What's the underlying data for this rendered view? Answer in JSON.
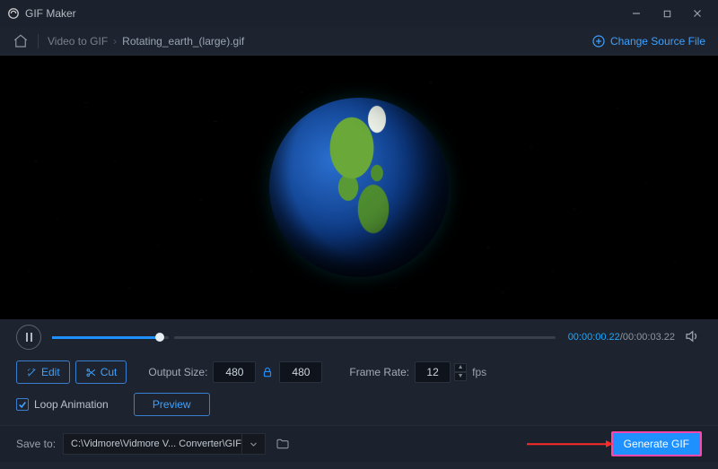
{
  "titlebar": {
    "title": "GIF Maker"
  },
  "breadcrumb": {
    "item1": "Video to GIF",
    "item2": "Rotating_earth_(large).gif",
    "change_source": "Change Source File"
  },
  "playback": {
    "current_time": "00:00:00.22",
    "total_time": "00:00:03.22"
  },
  "toolbar": {
    "edit_label": "Edit",
    "cut_label": "Cut",
    "output_size_label": "Output Size:",
    "output_width": "480",
    "output_height": "480",
    "frame_rate_label": "Frame Rate:",
    "frame_rate_value": "12",
    "fps_label": "fps"
  },
  "options": {
    "loop_animation_label": "Loop Animation",
    "preview_label": "Preview"
  },
  "savebar": {
    "save_to_label": "Save to:",
    "save_path": "C:\\Vidmore\\Vidmore V... Converter\\GIF Maker",
    "generate_label": "Generate GIF"
  }
}
